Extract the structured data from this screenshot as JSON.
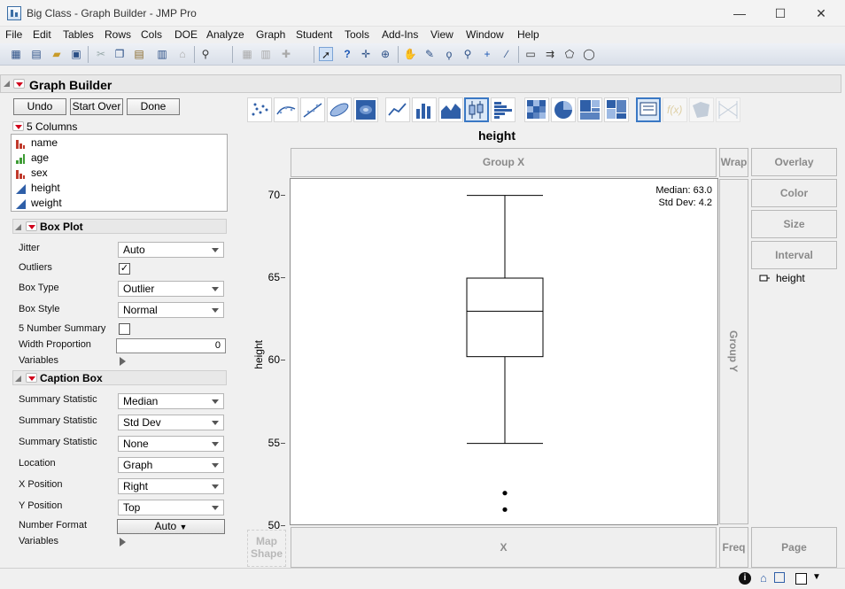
{
  "window": {
    "title": "Big Class - Graph Builder - JMP Pro",
    "minimize": "—",
    "maximize": "☐",
    "close": "✕"
  },
  "menu": [
    "File",
    "Edit",
    "Tables",
    "Rows",
    "Cols",
    "DOE",
    "Analyze",
    "Graph",
    "Student",
    "Tools",
    "Add-Ins",
    "View",
    "Window",
    "Help"
  ],
  "graph_builder": {
    "title": "Graph Builder",
    "buttons": {
      "undo": "Undo",
      "start_over": "Start Over",
      "done": "Done"
    },
    "columns_header": "5 Columns",
    "columns": [
      {
        "name": "name",
        "type": "nominal"
      },
      {
        "name": "age",
        "type": "ordinal"
      },
      {
        "name": "sex",
        "type": "nominal"
      },
      {
        "name": "height",
        "type": "continuous"
      },
      {
        "name": "weight",
        "type": "continuous"
      }
    ]
  },
  "box_plot": {
    "title": "Box Plot",
    "jitter_label": "Jitter",
    "jitter": "Auto",
    "outliers_label": "Outliers",
    "outliers_checked": true,
    "box_type_label": "Box Type",
    "box_type": "Outlier",
    "box_style_label": "Box Style",
    "box_style": "Normal",
    "five_num_label": "5 Number Summary",
    "five_num_checked": false,
    "width_prop_label": "Width Proportion",
    "width_prop": "0",
    "variables_label": "Variables"
  },
  "caption_box": {
    "title": "Caption Box",
    "stat_label": "Summary Statistic",
    "stat1": "Median",
    "stat2": "Std Dev",
    "stat3": "None",
    "location_label": "Location",
    "location": "Graph",
    "xpos_label": "X Position",
    "xpos": "Right",
    "ypos_label": "Y Position",
    "ypos": "Top",
    "numfmt_label": "Number Format",
    "numfmt": "Auto",
    "variables_label": "Variables"
  },
  "zones": {
    "group_x": "Group X",
    "wrap": "Wrap",
    "overlay": "Overlay",
    "color": "Color",
    "size": "Size",
    "interval": "Interval",
    "group_y": "Group Y",
    "x": "X",
    "freq": "Freq",
    "page": "Page",
    "map_shape_1": "Map",
    "map_shape_2": "Shape"
  },
  "legend": {
    "item": "height"
  },
  "chart_data": {
    "type": "box",
    "title": "height",
    "ylabel": "height",
    "xlabel": "",
    "ylim": [
      50,
      71
    ],
    "yticks": [
      50,
      55,
      60,
      65,
      70
    ],
    "ytick_labels": [
      "50",
      "55",
      "60",
      "65",
      "70"
    ],
    "box": {
      "whisker_low": 55,
      "q1": 60.25,
      "median": 63,
      "q3": 65,
      "whisker_high": 70
    },
    "outliers": [
      52,
      51
    ],
    "caption_lines": [
      "Median: 63.0",
      "Std Dev: 4.2"
    ],
    "grid": false
  },
  "colors": {
    "selected_border": "#3a78c4",
    "menu_red": "#d0021b",
    "nominal": "#c0392b",
    "ordinal": "#3e9c35",
    "continuous": "#2f5fa8"
  }
}
